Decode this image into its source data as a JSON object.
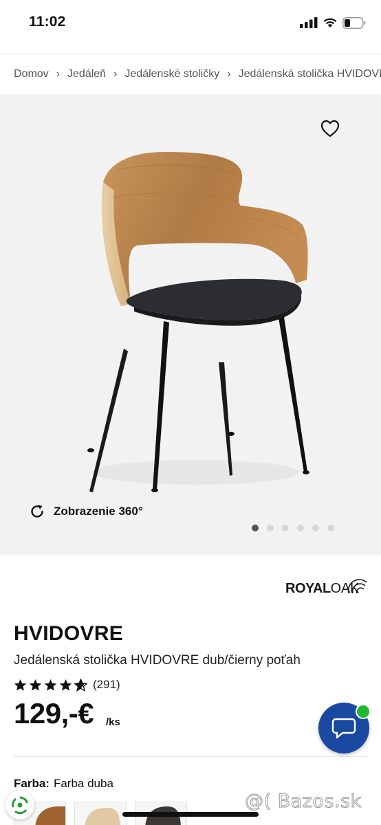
{
  "status_bar": {
    "time": "11:02"
  },
  "breadcrumb": {
    "items": [
      "Domov",
      "Jedáleň",
      "Jedálenské stoličky",
      "Jedálenská stolička HVIDOVRE dub/čierny poťah"
    ],
    "separator": "›"
  },
  "gallery": {
    "view360_label": "Zobrazenie 360°",
    "image_count": 6,
    "active_index": 0
  },
  "product": {
    "brand": {
      "part1": "ROYAL",
      "part2": "OAK"
    },
    "name": "HVIDOVRE",
    "description": "Jedálenská stolička HVIDOVRE dub/čierny poťah",
    "rating": 4.5,
    "review_count": "(291)",
    "price": "129,-€",
    "price_unit": "/ks"
  },
  "variant": {
    "label": "Farba:",
    "value": "Farba duba"
  },
  "watermark": "@( Bazos.sk",
  "colors": {
    "chat_button": "#1a49a1",
    "online": "#1fb832",
    "hero_bg": "#f2f2f2"
  },
  "icons": {
    "wishlist": "heart-icon",
    "rotate": "rotate-icon",
    "chat": "chat-bubble-icon"
  }
}
